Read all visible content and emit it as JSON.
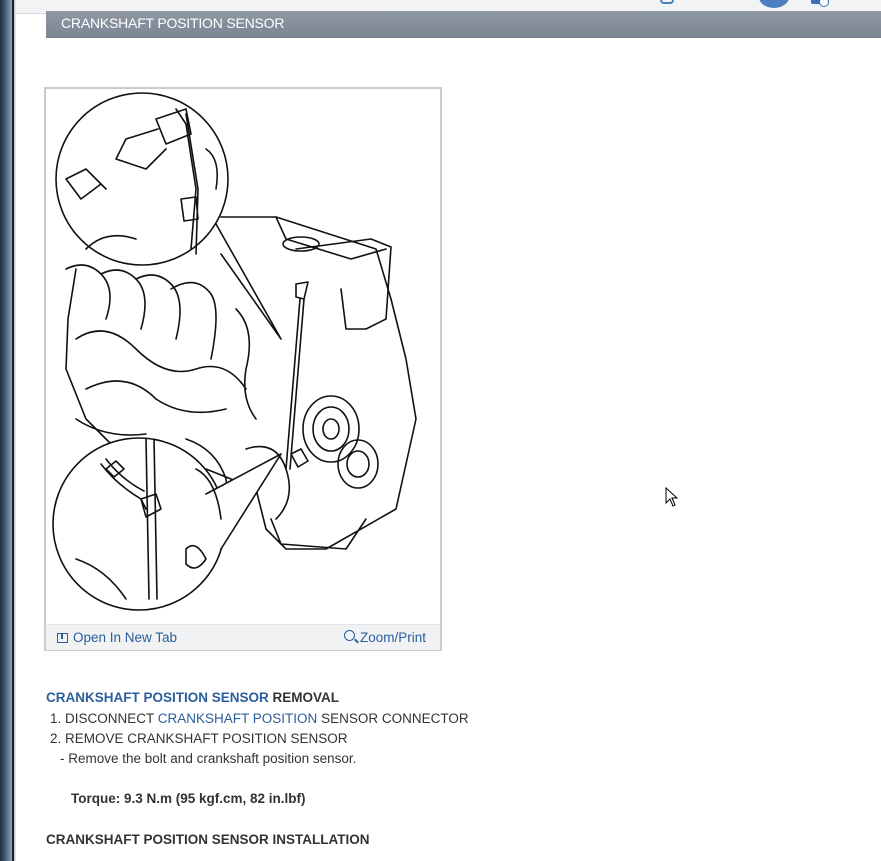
{
  "section_title": "CRANKSHAFT POSITION SENSOR",
  "figure": {
    "open_tab_label": "Open In New Tab",
    "zoom_label": "Zoom/Print",
    "image_description": "engine-line-drawing-with-sensor-callouts"
  },
  "removal": {
    "heading_link": "CRANKSHAFT POSITION SENSOR",
    "heading_suffix": "REMOVAL",
    "step1_prefix": "1. DISCONNECT ",
    "step1_link": "CRANKSHAFT POSITION",
    "step1_suffix": " SENSOR CONNECTOR",
    "step2": "2. REMOVE CRANKSHAFT POSITION SENSOR",
    "step2_detail": "-  Remove the bolt and crankshaft position sensor.",
    "torque": "Torque: 9.3 N.m (95 kgf.cm, 82 in.lbf)"
  },
  "installation": {
    "heading": "CRANKSHAFT POSITION SENSOR INSTALLATION"
  },
  "colors": {
    "header_bg": "#808a96",
    "link": "#2b5e9b",
    "text": "#333333"
  },
  "icons": [
    "chat-icon",
    "avatar",
    "add-icon",
    "open-tab-icon",
    "zoom-icon",
    "mouse-cursor"
  ]
}
